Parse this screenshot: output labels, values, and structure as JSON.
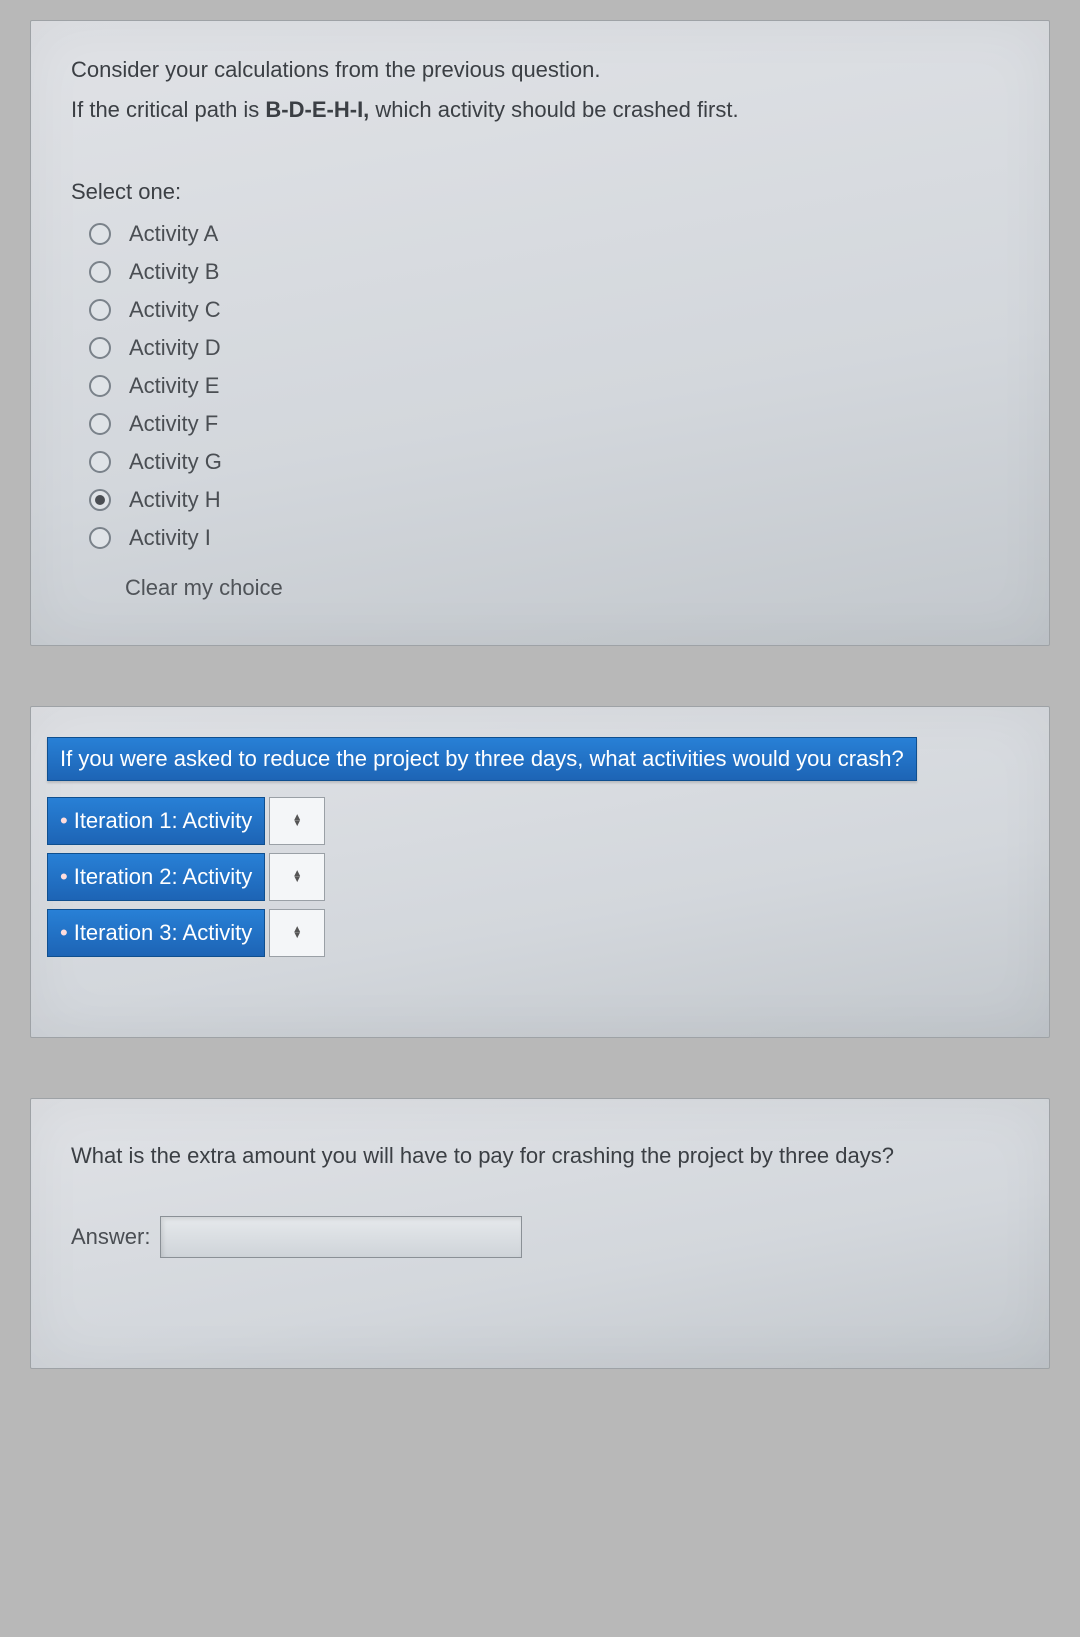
{
  "q1": {
    "line1": "Consider your calculations from the previous question.",
    "line2_pre": "If the critical path is ",
    "line2_bold": "B-D-E-H-I,",
    "line2_post": " which activity should be crashed first.",
    "select_one": "Select one:",
    "options": [
      {
        "label": "Activity A",
        "selected": false
      },
      {
        "label": "Activity B",
        "selected": false
      },
      {
        "label": "Activity C",
        "selected": false
      },
      {
        "label": "Activity D",
        "selected": false
      },
      {
        "label": "Activity E",
        "selected": false
      },
      {
        "label": "Activity F",
        "selected": false
      },
      {
        "label": "Activity G",
        "selected": false
      },
      {
        "label": "Activity H",
        "selected": true
      },
      {
        "label": "Activity I",
        "selected": false
      }
    ],
    "clear": "Clear my choice"
  },
  "q2": {
    "prompt": "If you were asked to reduce the project by three days, what activities would you crash?",
    "iterations": [
      {
        "label": "Iteration 1: Activity",
        "value": ""
      },
      {
        "label": "Iteration 2: Activity",
        "value": ""
      },
      {
        "label": "Iteration 3: Activity",
        "value": ""
      }
    ]
  },
  "q3": {
    "prompt": "What is the extra amount you will have to pay for crashing the project by three days?",
    "answer_label": "Answer:",
    "answer_value": ""
  }
}
